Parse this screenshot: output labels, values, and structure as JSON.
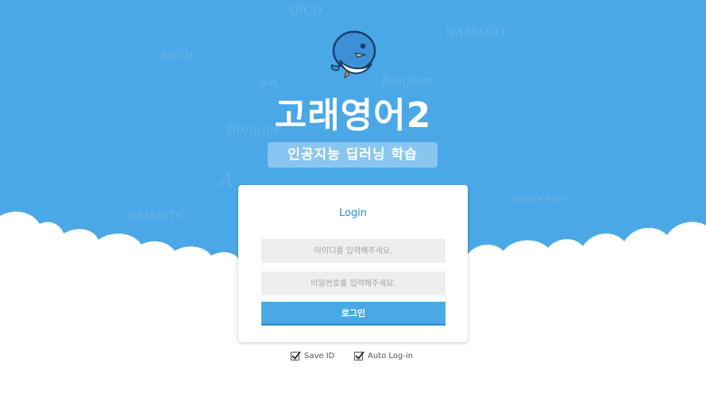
{
  "brand": {
    "title": "고래영어2",
    "subtitle": "인공지능 딥러닝 학습",
    "mascot_icon": "whale-icon"
  },
  "login": {
    "heading": "Login",
    "id_placeholder": "아이디를 입력해주세요.",
    "password_placeholder": "비밀번호를 입력해주세요.",
    "submit_label": "로그인"
  },
  "options": {
    "save_id": {
      "label": "Save ID",
      "checked": true
    },
    "auto_login": {
      "label": "Auto Log-in",
      "checked": true
    }
  },
  "background_doodles": [
    "ABCD",
    "NAMASTE",
    "Bonjour",
    "interpreter",
    "ola",
    "A",
    "ABCD",
    "NAMASTE",
    "Bonjour"
  ],
  "colors": {
    "sky": "#4aa8e6",
    "accent": "#2b8fd8",
    "button": "#4aa8e6",
    "input_bg": "#eeeeee"
  }
}
